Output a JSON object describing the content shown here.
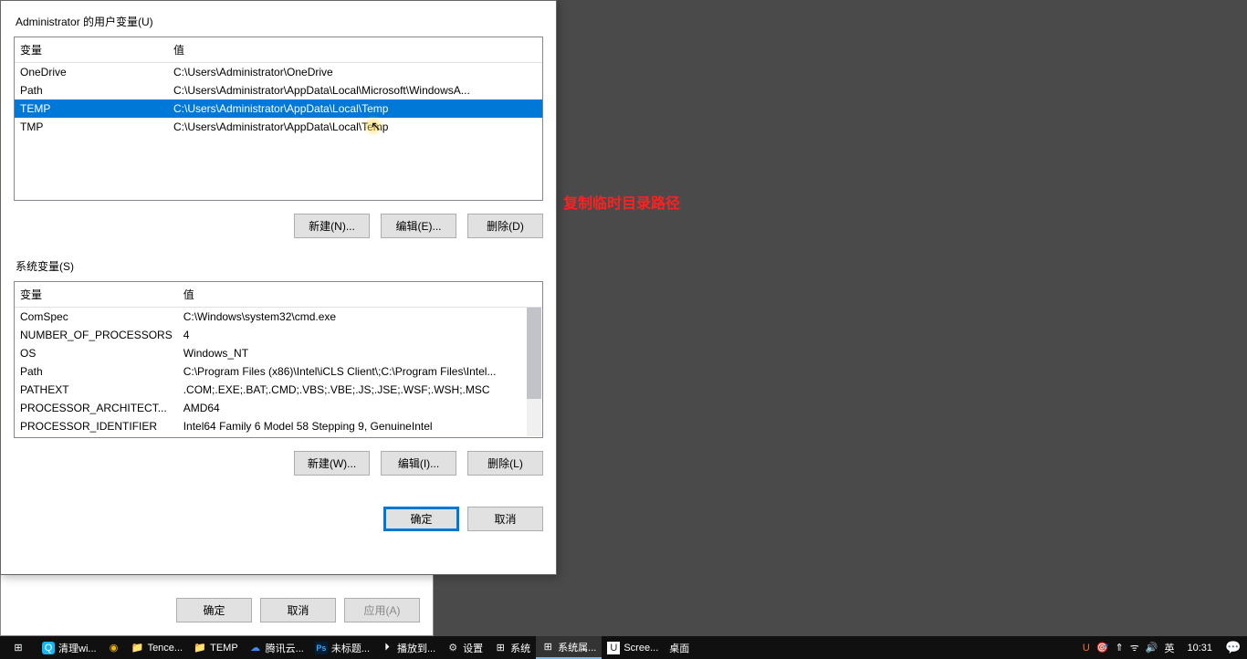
{
  "env_dialog": {
    "user_section_label": "Administrator 的用户变量(U)",
    "sys_section_label": "系统变量(S)",
    "headers": {
      "var": "变量",
      "val": "值"
    },
    "user_vars": [
      {
        "name": "OneDrive",
        "value": "C:\\Users\\Administrator\\OneDrive"
      },
      {
        "name": "Path",
        "value": "C:\\Users\\Administrator\\AppData\\Local\\Microsoft\\WindowsA..."
      },
      {
        "name": "TEMP",
        "value": "C:\\Users\\Administrator\\AppData\\Local\\Temp"
      },
      {
        "name": "TMP",
        "value": "C:\\Users\\Administrator\\AppData\\Local\\Temp"
      }
    ],
    "user_selected_index": 2,
    "sys_vars": [
      {
        "name": "ComSpec",
        "value": "C:\\Windows\\system32\\cmd.exe"
      },
      {
        "name": "NUMBER_OF_PROCESSORS",
        "value": "4"
      },
      {
        "name": "OS",
        "value": "Windows_NT"
      },
      {
        "name": "Path",
        "value": "C:\\Program Files (x86)\\Intel\\iCLS Client\\;C:\\Program Files\\Intel..."
      },
      {
        "name": "PATHEXT",
        "value": ".COM;.EXE;.BAT;.CMD;.VBS;.VBE;.JS;.JSE;.WSF;.WSH;.MSC"
      },
      {
        "name": "PROCESSOR_ARCHITECT...",
        "value": "AMD64"
      },
      {
        "name": "PROCESSOR_IDENTIFIER",
        "value": "Intel64 Family 6 Model 58 Stepping 9, GenuineIntel"
      }
    ],
    "buttons": {
      "user_new": "新建(N)...",
      "user_edit": "编辑(E)...",
      "user_delete": "删除(D)",
      "sys_new": "新建(W)...",
      "sys_edit": "编辑(I)...",
      "sys_delete": "删除(L)",
      "ok": "确定",
      "cancel": "取消"
    }
  },
  "parent_dialog": {
    "ok": "确定",
    "cancel": "取消",
    "apply": "应用(A)"
  },
  "annotation": "复制临时目录路径",
  "taskbar": {
    "items": [
      {
        "icon": "⊞",
        "label": ""
      },
      {
        "icon": "Q",
        "label": "清理wi..."
      },
      {
        "icon": "◉",
        "label": ""
      },
      {
        "icon": "📁",
        "label": "Tence..."
      },
      {
        "icon": "📁",
        "label": "TEMP"
      },
      {
        "icon": "☁",
        "label": "腾讯云..."
      },
      {
        "icon": "Ps",
        "label": "未标题..."
      },
      {
        "icon": "⏵",
        "label": "播放到..."
      },
      {
        "icon": "⚙",
        "label": "设置"
      },
      {
        "icon": "⊞",
        "label": "系统"
      },
      {
        "icon": "⊞",
        "label": "系统属..."
      },
      {
        "icon": "U",
        "label": "Scree..."
      },
      {
        "icon": "",
        "label": "桌面"
      }
    ],
    "tray": {
      "items": [
        "U",
        "ᯤ",
        "🔊",
        "英"
      ],
      "clock": "10:31",
      "notif": "💬"
    }
  }
}
